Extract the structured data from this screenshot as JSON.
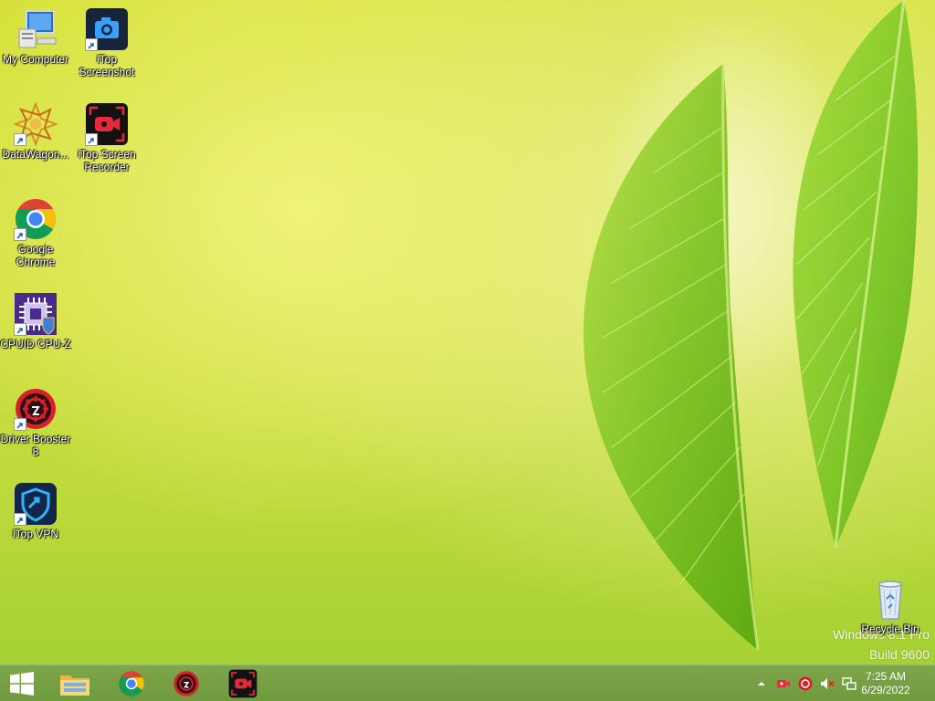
{
  "desktop": {
    "icons": [
      {
        "label": "My Computer",
        "icon": "computer-icon"
      },
      {
        "label": "iTop Screenshot",
        "icon": "itop-screenshot-icon"
      },
      {
        "label": "DataWagon...",
        "icon": "datawagon-icon"
      },
      {
        "label": "iTop Screen Recorder",
        "icon": "itop-screen-recorder-icon"
      },
      {
        "label": "Google Chrome",
        "icon": "chrome-icon"
      },
      {
        "label": "CPUID CPU-Z",
        "icon": "cpuz-icon"
      },
      {
        "label": "Driver Booster 8",
        "icon": "driver-booster-icon"
      },
      {
        "label": "iTop VPN",
        "icon": "itop-vpn-icon"
      },
      {
        "label": "Recycle Bin",
        "icon": "recycle-bin-icon"
      }
    ],
    "watermark": {
      "line1": "Windows 8.1 Pro",
      "line2": "Build 9600"
    }
  },
  "taskbar": {
    "pinned": [
      {
        "name": "start",
        "icon": "windows-logo-icon"
      },
      {
        "name": "file-explorer",
        "icon": "folder-icon"
      },
      {
        "name": "chrome",
        "icon": "chrome-icon"
      },
      {
        "name": "driver-booster",
        "icon": "driver-booster-icon"
      },
      {
        "name": "itop-screen-recorder",
        "icon": "itop-screen-recorder-icon"
      }
    ],
    "tray": [
      "chevron-up-icon",
      "recorder-tray-icon",
      "driver-booster-tray-icon",
      "volume-muted-icon",
      "network-icon"
    ],
    "clock": {
      "time": "7:25 AM",
      "date": "6/29/2022"
    }
  },
  "colors": {
    "taskbar": "#759f44",
    "accent": "#d6e23a"
  }
}
